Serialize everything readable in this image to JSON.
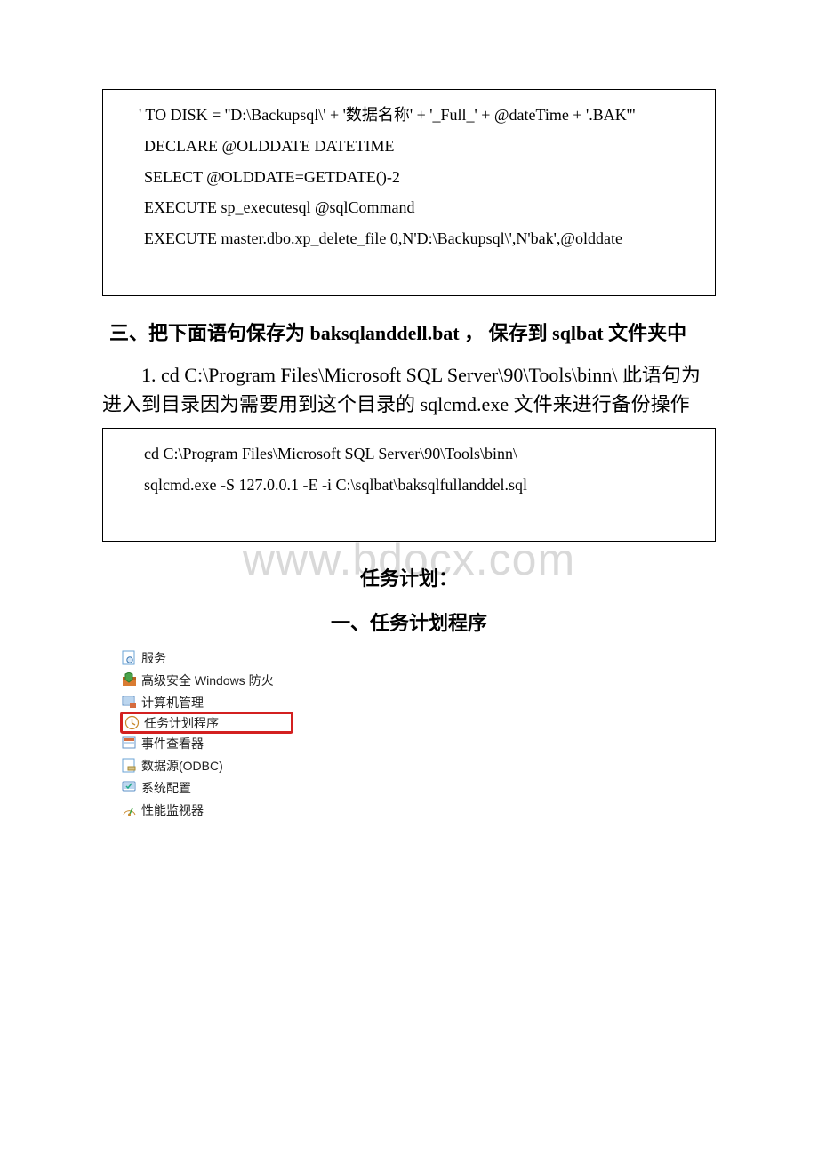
{
  "codebox1": {
    "line1": "   ' TO DISK = ''D:\\Backupsql\\' + '数据名称' + '_Full_' + @dateTime + '.BAK'''",
    "line2": "DECLARE @OLDDATE DATETIME",
    "line3": "SELECT @OLDDATE=GETDATE()-2",
    "line4": "EXECUTE sp_executesql @sqlCommand",
    "line5": "EXECUTE master.dbo.xp_delete_file 0,N'D:\\Backupsql\\',N'bak',@olddate"
  },
  "section3_title": "三、把下面语句保存为 baksqlanddell.bat ， 保存到 sqlbat 文件夹中",
  "section3_body": "1. cd C:\\Program Files\\Microsoft SQL Server\\90\\Tools\\binn\\ 此语句为进入到目录因为需要用到这个目录的 sqlcmd.exe 文件来进行备份操作",
  "codebox2": {
    "line1": "cd C:\\Program Files\\Microsoft SQL Server\\90\\Tools\\binn\\",
    "line2": "sqlcmd.exe -S 127.0.0.1 -E -i C:\\sqlbat\\baksqlfullanddel.sql"
  },
  "watermark": "www.bdocx.com",
  "task_plan_label": "任务计划：",
  "task_plan_section1": "一、任务计划程序",
  "menu": {
    "items": [
      "服务",
      "高级安全 Windows 防火",
      "计算机管理",
      "任务计划程序",
      "事件查看器",
      "数据源(ODBC)",
      "系统配置",
      "性能监视器"
    ],
    "highlighted_index": 3
  }
}
